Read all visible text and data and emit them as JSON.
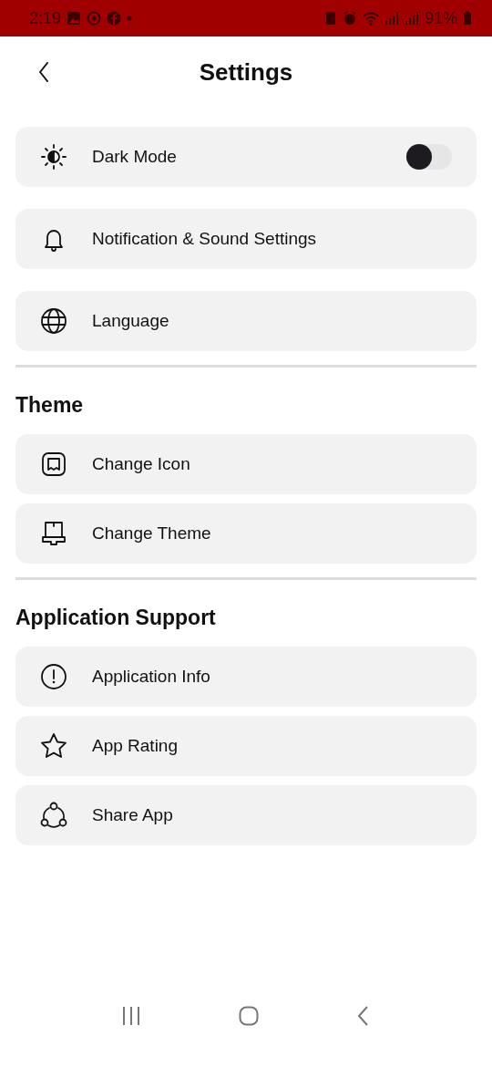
{
  "status_bar": {
    "time": "2:19",
    "battery": "91%"
  },
  "header": {
    "title": "Settings"
  },
  "sections": [
    {
      "items": [
        {
          "label": "Dark Mode",
          "kind": "toggle",
          "on": false
        },
        {
          "label": "Notification & Sound Settings",
          "kind": "link"
        },
        {
          "label": "Language",
          "kind": "link"
        }
      ]
    },
    {
      "heading": "Theme",
      "items": [
        {
          "label": "Change Icon",
          "kind": "link"
        },
        {
          "label": "Change Theme",
          "kind": "link"
        }
      ]
    },
    {
      "heading": "Application Support",
      "items": [
        {
          "label": "Application Info",
          "kind": "link"
        },
        {
          "label": "App Rating",
          "kind": "link"
        },
        {
          "label": "Share App",
          "kind": "link"
        }
      ]
    }
  ]
}
